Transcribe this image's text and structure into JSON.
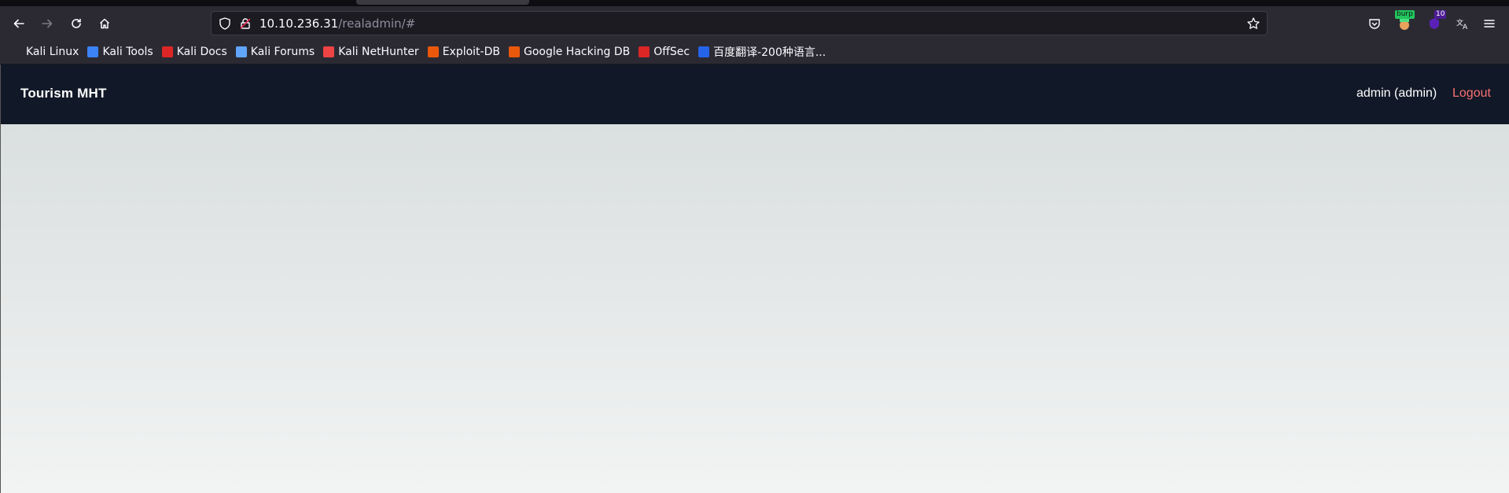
{
  "browser": {
    "url_host": "10.10.236.31",
    "url_path": "/realadmin/#",
    "extension_burp_label": "burp",
    "extension_count_badge": "10",
    "bookmarks": [
      {
        "label": "Kali Linux",
        "icon": "kali-dragon-icon",
        "color": "#2b2a33"
      },
      {
        "label": "Kali Tools",
        "icon": "kali-tools-icon",
        "color": "#3b82f6"
      },
      {
        "label": "Kali Docs",
        "icon": "kali-docs-icon",
        "color": "#dc2626"
      },
      {
        "label": "Kali Forums",
        "icon": "kali-forums-icon",
        "color": "#60a5fa"
      },
      {
        "label": "Kali NetHunter",
        "icon": "kali-nethunter-icon",
        "color": "#ef4444"
      },
      {
        "label": "Exploit-DB",
        "icon": "exploit-db-icon",
        "color": "#ea580c"
      },
      {
        "label": "Google Hacking DB",
        "icon": "ghdb-icon",
        "color": "#ea580c"
      },
      {
        "label": "OffSec",
        "icon": "offsec-icon",
        "color": "#dc2626"
      },
      {
        "label": "百度翻译-200种语言...",
        "icon": "baidu-translate-icon",
        "color": "#2563eb"
      }
    ]
  },
  "app": {
    "brand": "Tourism MHT",
    "user_label": "admin (admin)",
    "logout_label": "Logout",
    "navbar_color": "#111827",
    "logout_color": "#f87171"
  }
}
